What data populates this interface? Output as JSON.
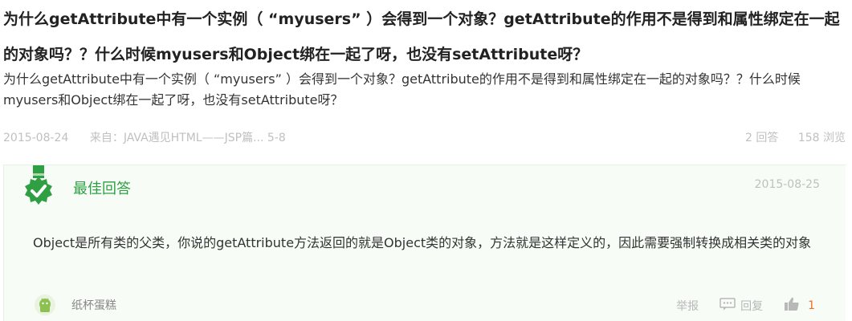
{
  "question": {
    "title": "为什么getAttribute中有一个实例（ “myusers” ）会得到一个对象？getAttribute的作用不是得到和属性绑定在一起的对象吗？？什么时候myusers和Object绑在一起了呀，也没有setAttribute呀？",
    "description": "为什么getAttribute中有一个实例（ “myusers” ）会得到一个对象？getAttribute的作用不是得到和属性绑定在一起的对象吗？？什么时候myusers和Object绑在一起了呀，也没有setAttribute呀？"
  },
  "meta": {
    "date": "2015-08-24",
    "source": "来自：JAVA遇见HTML——JSP篇... 5-8",
    "answers": "2 回答",
    "views": "158 浏览"
  },
  "answer": {
    "badge_icon": "best-answer-badge-icon",
    "best_label": "最佳回答",
    "date": "2015-08-25",
    "body": "Object是所有类的父类，你说的getAttribute方法返回的就是Object类的对象，方法就是这样定义的，因此需要强制转换成相关类的对象",
    "username": "纸杯蛋糕",
    "report_label": "举报",
    "reply_label": "回复",
    "like_count": "1"
  },
  "colors": {
    "accent_green": "#2ea043",
    "like_orange": "#f26c2a",
    "meta_gray": "#c0c0c0"
  }
}
